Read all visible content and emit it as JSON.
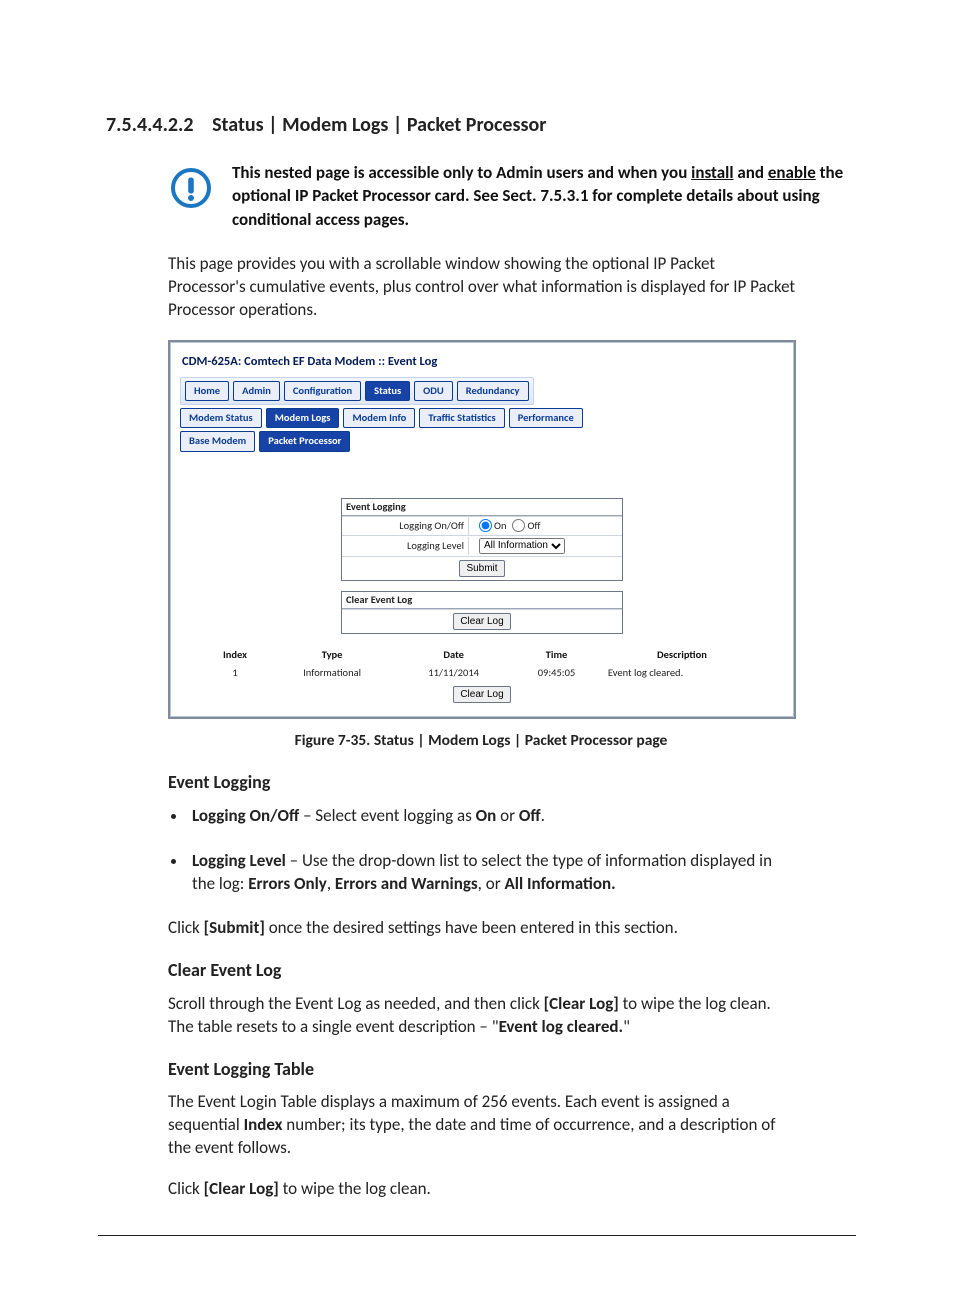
{
  "heading": {
    "number": "7.5.4.4.2.2",
    "title": "Status | Modem Logs | Packet Processor"
  },
  "note": {
    "pre": "This nested page is accessible only to Admin users and when you ",
    "u1": "install",
    "mid1": " and ",
    "u2": "enable",
    "post": " the optional IP Packet Processor card. See Sect. 7.5.3.1 for complete details about using conditional access pages."
  },
  "intro": "This page provides you with a scrollable window showing the optional IP Packet Processor's cumulative events, plus control over what information is displayed for IP Packet Processor operations.",
  "embed": {
    "title": "CDM-625A: Comtech EF Data Modem :: Event Log",
    "tabs_row1": [
      "Home",
      "Admin",
      "Configuration",
      "Status",
      "ODU",
      "Redundancy"
    ],
    "tabs_row1_active": "Status",
    "tabs_row2": [
      "Modem Status",
      "Modem Logs",
      "Modem Info",
      "Traffic Statistics",
      "Performance"
    ],
    "tabs_row2_active": "Modem Logs",
    "tabs_row3": [
      "Base Modem",
      "Packet Processor"
    ],
    "tabs_row3_active": "Packet Processor",
    "panel_event_logging": {
      "header": "Event Logging",
      "row_onoff_label": "Logging On/Off",
      "on_label": "On",
      "off_label": "Off",
      "row_level_label": "Logging Level",
      "level_value": "All Information",
      "submit": "Submit"
    },
    "panel_clear": {
      "header": "Clear Event Log",
      "button": "Clear Log"
    },
    "table": {
      "headers": [
        "Index",
        "Type",
        "Date",
        "Time",
        "Description"
      ],
      "row": {
        "index": "1",
        "type": "Informational",
        "date": "11/11/2014",
        "time": "09:45:05",
        "desc": "Event log cleared."
      },
      "button": "Clear Log"
    }
  },
  "caption": "Figure 7-35. Status | Modem Logs | Packet Processor page",
  "sections": {
    "event_logging": {
      "title": "Event Logging",
      "b1_label": "Logging On/Off",
      "b1_text_a": " – Select event logging as ",
      "b1_on": "On",
      "b1_text_b": " or ",
      "b1_off": "Off",
      "b1_text_c": ".",
      "b2_label": "Logging Level",
      "b2_text_a": " – Use the drop-down list to select the type of information displayed in the log: ",
      "b2_opt1": "Errors Only",
      "b2_sep1": ", ",
      "b2_opt2": "Errors and Warnings",
      "b2_sep2": ", or ",
      "b2_opt3": "All Information.",
      "submit_a": "Click ",
      "submit_btn": "[Submit]",
      "submit_b": " once the desired settings have been entered in this section."
    },
    "clear": {
      "title": "Clear Event Log",
      "text_a": "Scroll through the Event Log as needed, and then click ",
      "btn": "[Clear Log]",
      "text_b": " to wipe the log clean. The table resets to a single event description – \"",
      "cleared": "Event log cleared.",
      "text_c": "\""
    },
    "table": {
      "title": "Event Logging Table",
      "text_a": "The Event Login Table displays a maximum of 256 events. Each event is assigned a sequential ",
      "idx": "Index",
      "text_b": " number; its type, the date and time of occurrence, and a description of the event follows.",
      "text_c_a": "Click ",
      "btn": "[Clear Log]",
      "text_c_b": " to wipe the log clean."
    }
  }
}
